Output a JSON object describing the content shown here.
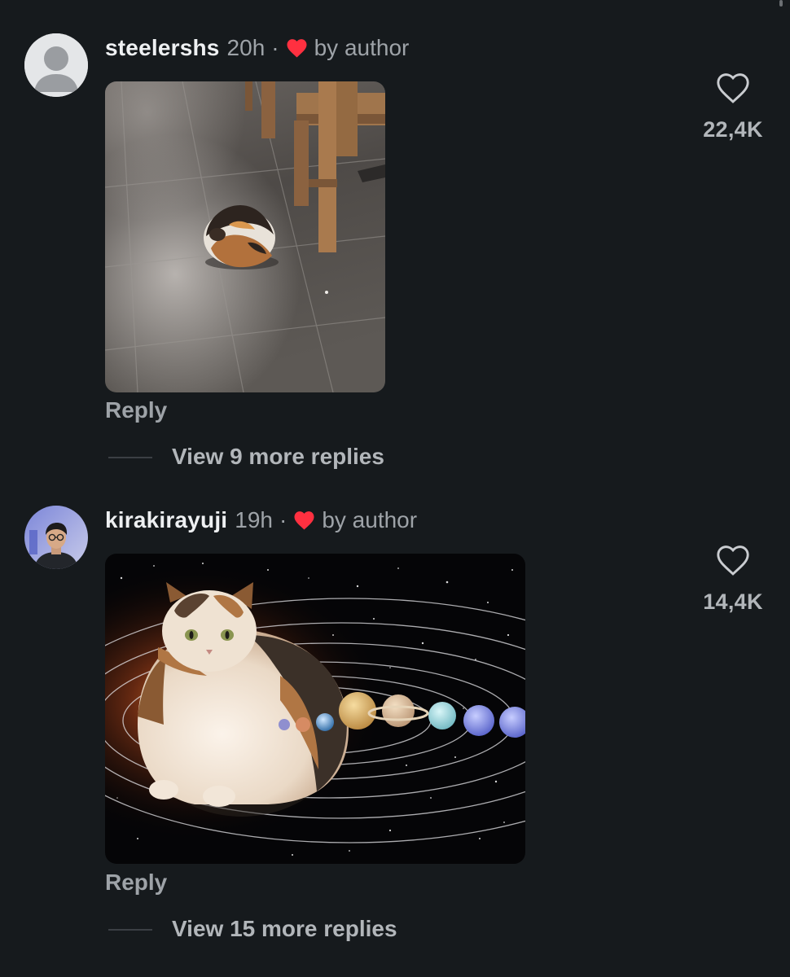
{
  "comments": [
    {
      "username": "steelershs",
      "time": "20h",
      "separator": "·",
      "author_badge": "by author",
      "reply_label": "Reply",
      "view_replies": "View 9 more replies",
      "like_count": "22,4K",
      "media": "photo: loaf-shaped calico cat sitting on a tiled floor beside a wooden chair"
    },
    {
      "username": "kirakirayuji",
      "time": "19h",
      "separator": "·",
      "author_badge": "by author",
      "reply_label": "Reply",
      "view_replies": "View 15 more replies",
      "like_count": "14,4K",
      "media": "image: large calico cat placed as the sun of a solar system with planets in orbit"
    }
  ],
  "colors": {
    "background": "#161a1d",
    "username": "#eef0f2",
    "muted_text": "#9ea3a8",
    "author_heart": "#ff3040"
  },
  "icons": [
    "default-avatar-icon",
    "heart-filled-icon",
    "heart-outline-icon"
  ]
}
